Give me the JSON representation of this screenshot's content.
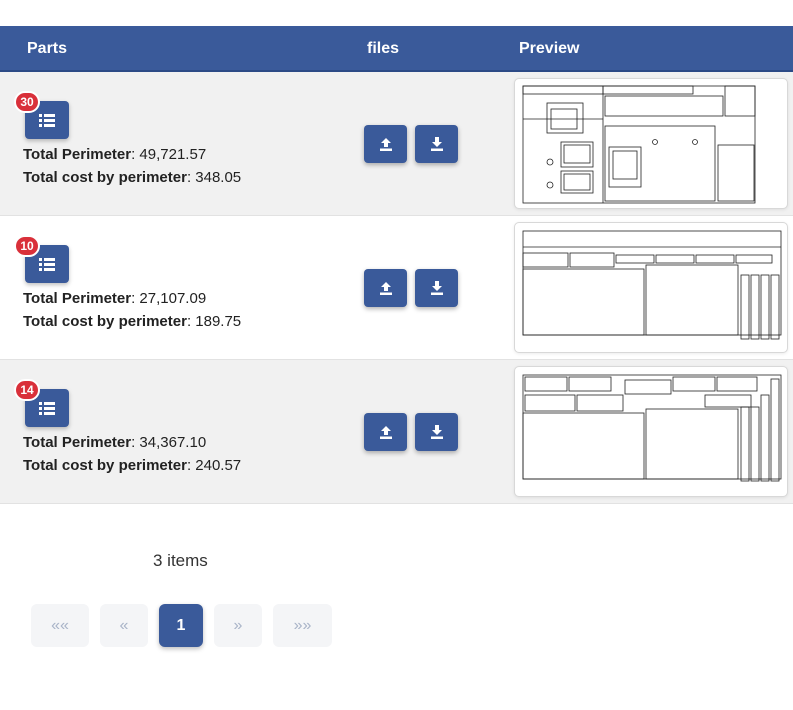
{
  "table": {
    "headers": {
      "parts": "Parts",
      "files": "files",
      "preview": "Preview"
    },
    "rows": [
      {
        "badge": "30",
        "perimeter_label": "Total Perimeter",
        "perimeter_value": ": 49,721.57",
        "cost_label": "Total cost by perimeter",
        "cost_value": ": 348.05"
      },
      {
        "badge": "10",
        "perimeter_label": "Total Perimeter",
        "perimeter_value": ": 27,107.09",
        "cost_label": "Total cost by perimeter",
        "cost_value": ": 189.75"
      },
      {
        "badge": "14",
        "perimeter_label": "Total Perimeter",
        "perimeter_value": ": 34,367.10",
        "cost_label": "Total cost by perimeter",
        "cost_value": ": 240.57"
      }
    ]
  },
  "pagination": {
    "items_text": "3 items",
    "first": "««",
    "prev": "«",
    "current": "1",
    "next": "»",
    "last": "»»"
  },
  "icons": {
    "parts_list": "list-icon",
    "upload": "upload-icon",
    "download": "download-icon",
    "preview": "cad-drawing-thumbnail"
  },
  "colors": {
    "header_bg": "#3a5a9a",
    "button_bg": "#3a5a9a",
    "badge_bg": "#d9303a",
    "row_alt_bg": "#f1f1f1"
  }
}
